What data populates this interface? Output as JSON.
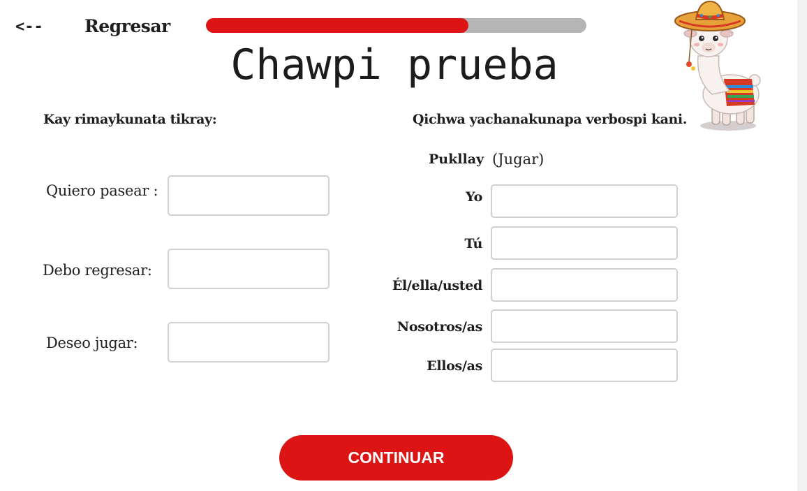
{
  "nav": {
    "back_arrow": "<--",
    "back_label": "Regresar"
  },
  "progress": {
    "value": 0.69,
    "fill_color": "#dd1414",
    "track_color": "#b5b5b5"
  },
  "title": "Chawpi prueba",
  "left_section": {
    "instruction": "Kay rimaykunata tikray:",
    "phrases": [
      {
        "label": "Quiero pasear :",
        "value": ""
      },
      {
        "label": "Debo regresar:",
        "value": ""
      },
      {
        "label": "Deseo jugar:",
        "value": ""
      }
    ]
  },
  "right_section": {
    "instruction": "Qichwa yachanakunapa verbospi kani.",
    "verb": {
      "root": "Pukllay",
      "gloss": "(Jugar)"
    },
    "pronouns": [
      {
        "label": "Yo",
        "value": ""
      },
      {
        "label": "Tú",
        "value": ""
      },
      {
        "label": "Él/ella/usted",
        "value": ""
      },
      {
        "label": "Nosotros/as",
        "value": ""
      },
      {
        "label": "Ellos/as",
        "value": ""
      }
    ]
  },
  "continue_label": "CONTINUAR",
  "mascot": {
    "icon": "llama-sombrero-icon"
  },
  "colors": {
    "accent": "#dd1414",
    "text": "#1e1e1e",
    "input_border": "#cfcfcf"
  }
}
